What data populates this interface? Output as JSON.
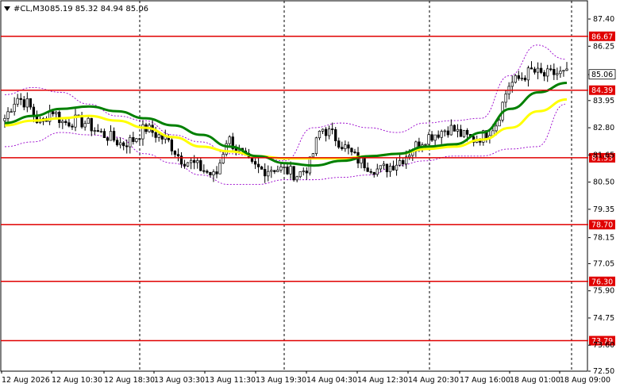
{
  "header": {
    "symbol": "#CL,M30",
    "ohlc": "85.19 85.32 84.94 85.06"
  },
  "chart_data": {
    "type": "candlestick",
    "symbol": "#CL",
    "timeframe": "M30",
    "ylim": [
      72.5,
      88.0
    ],
    "y_ticks": [
      87.4,
      86.25,
      85.05,
      83.95,
      82.8,
      81.65,
      80.5,
      79.35,
      78.15,
      77.05,
      75.9,
      74.75,
      73.6,
      72.5
    ],
    "x_tick_labels": [
      "12 Aug 2026",
      "12 Aug 10:30",
      "12 Aug 18:30",
      "13 Aug 03:30",
      "13 Aug 11:30",
      "13 Aug 19:30",
      "14 Aug 04:30",
      "14 Aug 12:30",
      "14 Aug 20:30",
      "17 Aug 16:00",
      "18 Aug 01:00",
      "18 Aug 09:00"
    ],
    "current_price": 85.06,
    "horizontal_levels": [
      86.67,
      84.39,
      81.53,
      78.7,
      76.3,
      73.79
    ],
    "ohlc_last": {
      "open": 85.19,
      "high": 85.32,
      "low": 84.94,
      "close": 85.06
    },
    "grid": true,
    "series": [
      {
        "kind": "candles",
        "key_closes": [
          83.2,
          84.1,
          83.8,
          82.9,
          83.6,
          83.0,
          83.1,
          83.0,
          82.6,
          82.4,
          82.1,
          82.3,
          82.8,
          82.5,
          82.2,
          81.5,
          81.3,
          81.0,
          80.7,
          82.4,
          81.8,
          81.2,
          81.0,
          81.1,
          81.0,
          80.8,
          81.2,
          82.8,
          82.5,
          82.0,
          81.5,
          81.2,
          81.0,
          81.2,
          81.5,
          82.0,
          82.4,
          82.6,
          82.8,
          82.5,
          82.3,
          82.5,
          83.0,
          84.6,
          84.9,
          85.2,
          85.0,
          85.1,
          85.06
        ],
        "color_up": "#000000",
        "color_down": "#000000"
      },
      {
        "kind": "moving_average",
        "color": "#008000",
        "values": [
          83.0,
          83.3,
          83.6,
          83.7,
          83.5,
          83.2,
          82.9,
          82.5,
          82.0,
          81.6,
          81.3,
          81.2,
          81.4,
          81.6,
          81.7,
          82.0,
          82.1,
          82.6,
          83.6,
          84.3,
          84.7
        ]
      },
      {
        "kind": "moving_average",
        "color": "#ffff00",
        "values": [
          82.9,
          83.1,
          83.2,
          83.3,
          83.1,
          82.8,
          82.4,
          82.0,
          81.8,
          81.6,
          81.5,
          81.5,
          81.5,
          81.6,
          81.7,
          81.9,
          82.0,
          82.3,
          82.8,
          83.5,
          84.0
        ]
      },
      {
        "kind": "bollinger_band",
        "color": "#9900cc",
        "upper": [
          84.2,
          84.5,
          84.3,
          83.8,
          83.3,
          83.1,
          82.5,
          82.2,
          81.7,
          81.6,
          81.4,
          82.8,
          83.0,
          82.8,
          82.6,
          83.0,
          83.1,
          83.2,
          85.0,
          86.3,
          85.7
        ],
        "lower": [
          82.0,
          82.2,
          82.6,
          82.5,
          82.4,
          81.7,
          81.3,
          80.8,
          80.4,
          80.4,
          80.6,
          80.6,
          80.7,
          80.8,
          81.2,
          81.4,
          81.6,
          81.6,
          81.9,
          82.0,
          83.8
        ]
      }
    ]
  }
}
